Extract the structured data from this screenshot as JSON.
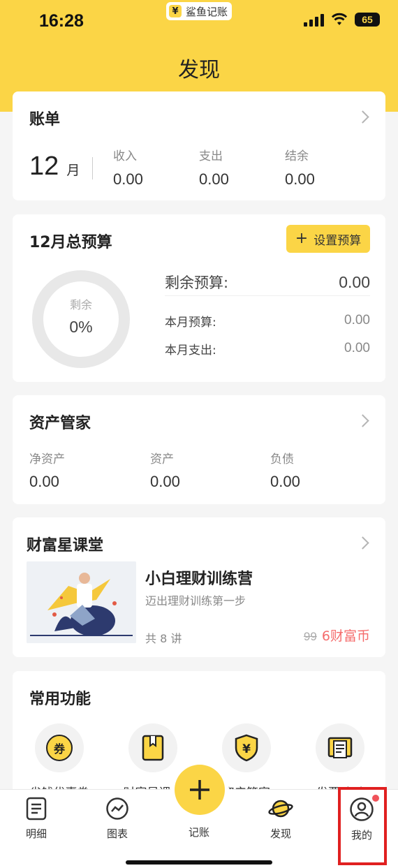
{
  "status": {
    "time": "16:28",
    "app_name": "鲨鱼记账",
    "battery": "65"
  },
  "page": {
    "title": "发现"
  },
  "bill": {
    "title": "账单",
    "month": "12",
    "month_unit": "月",
    "income_label": "收入",
    "income": "0.00",
    "expense_label": "支出",
    "expense": "0.00",
    "balance_label": "结余",
    "balance": "0.00"
  },
  "budget": {
    "title": "12月总预算",
    "set_button": "设置预算",
    "ring_label": "剩余",
    "ring_percent": "0%",
    "remaining_label": "剩余预算:",
    "remaining": "0.00",
    "month_budget_label": "本月预算:",
    "month_budget": "0.00",
    "month_expense_label": "本月支出:",
    "month_expense": "0.00"
  },
  "assets": {
    "title": "资产管家",
    "net_label": "净资产",
    "net": "0.00",
    "asset_label": "资产",
    "asset": "0.00",
    "debt_label": "负债",
    "debt": "0.00"
  },
  "course": {
    "section_title": "财富星课堂",
    "name": "小白理财训练营",
    "subtitle": "迈出理财训练第一步",
    "lessons": "共 8 讲",
    "old_price": "99",
    "price": "6财富币"
  },
  "functions": {
    "title": "常用功能",
    "items": [
      {
        "label": "省钱优惠券",
        "icon": "coupon-icon"
      },
      {
        "label": "财富星课堂",
        "icon": "book-icon"
      },
      {
        "label": "资产管家",
        "icon": "shield-yen-icon"
      },
      {
        "label": "发票助手",
        "icon": "receipt-icon"
      }
    ]
  },
  "tabbar": {
    "items": [
      {
        "label": "明细",
        "icon": "list-icon"
      },
      {
        "label": "图表",
        "icon": "chart-icon"
      },
      {
        "label": "记账",
        "icon": "plus-icon"
      },
      {
        "label": "发现",
        "icon": "planet-icon"
      },
      {
        "label": "我的",
        "icon": "user-icon"
      }
    ]
  },
  "colors": {
    "accent": "#fbd546",
    "price_red": "#f56c6c"
  }
}
